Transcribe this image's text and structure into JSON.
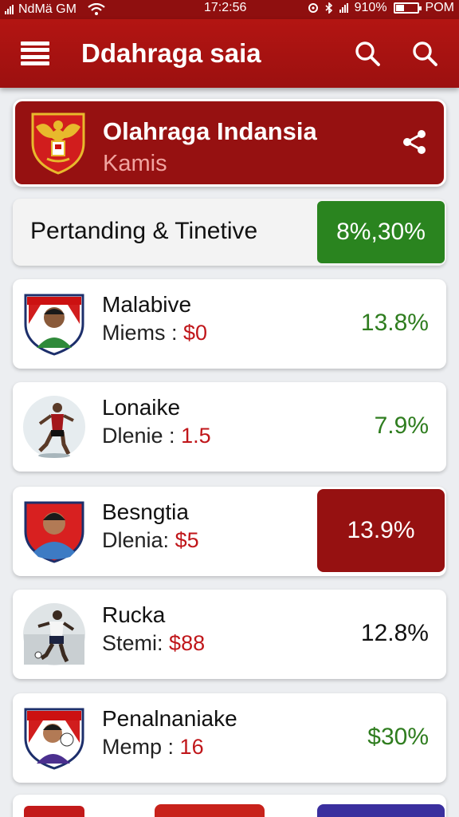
{
  "status_bar": {
    "carrier": "NdMä GM",
    "time": "17:2:56",
    "battery_text": "910%",
    "right_label": "POM"
  },
  "app_bar": {
    "title": "Ddahraga saia",
    "icons": [
      "menu-icon",
      "search-icon",
      "search-icon"
    ]
  },
  "banner": {
    "title": "Olahraga Indansia",
    "subtitle": "Kamis",
    "emblem": "garuda-emblem",
    "share_icon": "share-icon"
  },
  "summary": {
    "label": "Pertanding & Tinetive",
    "value": "8%,30%",
    "badge_color": "#2a841f"
  },
  "players": [
    {
      "name": "Malabive",
      "meta_label": "Miems :",
      "meta_value": "$0",
      "percent": "13.8%",
      "percent_style": "green"
    },
    {
      "name": "Lonaike",
      "meta_label": "Dlenie :",
      "meta_value": "1.5",
      "percent": "7.9%",
      "percent_style": "green"
    },
    {
      "name": "Besngtia",
      "meta_label": "Dlenia:",
      "meta_value": "$5",
      "percent": "13.9%",
      "percent_style": "highlight"
    },
    {
      "name": "Rucka",
      "meta_label": "Stemi:",
      "meta_value": "$88",
      "percent": "12.8%",
      "percent_style": "black"
    },
    {
      "name": "Penalnaniake",
      "meta_label": "Memp :",
      "meta_value": "16",
      "percent": "$30%",
      "percent_style": "green"
    }
  ],
  "colors": {
    "primary": "#9c1010",
    "accent_green": "#2a841f",
    "value_red": "#c0161a"
  }
}
